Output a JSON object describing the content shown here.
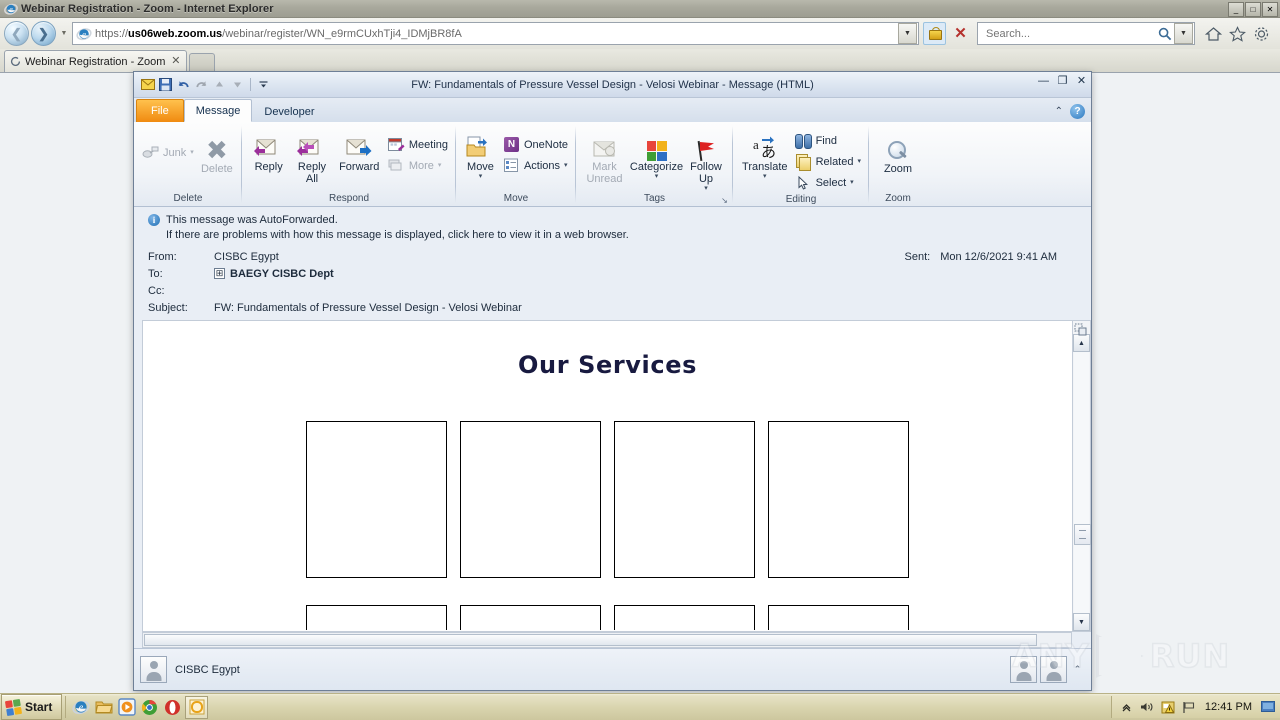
{
  "browser": {
    "title": "Webinar Registration - Zoom - Internet Explorer",
    "icon": "internet-explorer-icon",
    "url_scheme": "https://",
    "url_host": "us06web.zoom.us",
    "url_path": "/webinar/register/WN_e9rmCUxhTji4_IDMjBR8fA",
    "search_placeholder": "Search...",
    "tab_label": "Webinar Registration - Zoom",
    "minimize": "_",
    "restore": "□",
    "close": "✕",
    "back_icon": "back-arrow-icon",
    "forward_icon": "forward-arrow-icon",
    "home_icon": "home-icon",
    "favorites_icon": "star-icon",
    "tools_icon": "gear-icon",
    "lock_icon": "security-lock-icon",
    "stop_icon": "stop-red-x-icon"
  },
  "outlook": {
    "title": "FW: Fundamentals of Pressure Vessel Design - Velosi Webinar  -  Message (HTML)",
    "quick_access": [
      {
        "name": "envelope-icon",
        "glyph": "✉"
      },
      {
        "name": "save-icon",
        "glyph": "■"
      },
      {
        "name": "undo-icon",
        "glyph": "↶"
      },
      {
        "name": "redo-icon",
        "glyph": "↷"
      },
      {
        "name": "previous-item-icon",
        "glyph": "▲"
      },
      {
        "name": "next-item-icon",
        "glyph": "▼"
      },
      {
        "name": "customize-qat-icon",
        "glyph": "▾"
      }
    ],
    "sys": {
      "minimize": "—",
      "restore": "❐",
      "close": "✕"
    },
    "tabs": [
      {
        "label": "File",
        "state": "file"
      },
      {
        "label": "Message",
        "state": "active"
      },
      {
        "label": "Developer",
        "state": "normal"
      }
    ],
    "ribbon_right": {
      "collapse": "⌃",
      "help": "?"
    },
    "ribbon_groups": [
      {
        "name": "Delete",
        "items": [
          {
            "label": "Junk",
            "icon": "junk-icon",
            "type": "small",
            "disabled": true,
            "caret": "▾"
          },
          {
            "label": "Delete",
            "icon": "delete-x-icon",
            "type": "big",
            "disabled": true
          }
        ]
      },
      {
        "name": "Respond",
        "items": [
          {
            "label": "Reply",
            "icon": "reply-icon",
            "type": "big"
          },
          {
            "label": "Reply\nAll",
            "icon": "reply-all-icon",
            "type": "big"
          },
          {
            "label": "Forward",
            "icon": "forward-mail-icon",
            "type": "big"
          },
          {
            "label": "Meeting",
            "icon": "meeting-calendar-icon",
            "type": "small"
          },
          {
            "label": "More",
            "icon": "more-icon",
            "type": "small",
            "disabled": true,
            "caret": "▾"
          }
        ]
      },
      {
        "name": "Move",
        "items": [
          {
            "label": "Move",
            "icon": "move-folder-icon",
            "type": "big",
            "caret": "▾"
          },
          {
            "label": "OneNote",
            "icon": "onenote-icon",
            "type": "small"
          },
          {
            "label": "Actions",
            "icon": "actions-icon",
            "type": "small",
            "caret": "▾"
          }
        ]
      },
      {
        "name": "Tags",
        "items": [
          {
            "label": "Mark\nUnread",
            "icon": "mark-unread-icon",
            "type": "big",
            "disabled": true
          },
          {
            "label": "Categorize",
            "icon": "categorize-icon",
            "type": "big",
            "caret": "▾"
          },
          {
            "label": "Follow\nUp",
            "icon": "follow-up-flag-icon",
            "type": "big",
            "caret": "▾"
          }
        ],
        "dialog_launcher": "↘"
      },
      {
        "name": "Editing",
        "items": [
          {
            "label": "Translate",
            "icon": "translate-icon",
            "type": "big",
            "caret": "▾"
          },
          {
            "label": "Find",
            "icon": "find-binoculars-icon",
            "type": "small"
          },
          {
            "label": "Related",
            "icon": "related-icon",
            "type": "small",
            "caret": "▾"
          },
          {
            "label": "Select",
            "icon": "select-cursor-icon",
            "type": "small",
            "caret": "▾"
          }
        ]
      },
      {
        "name": "Zoom",
        "items": [
          {
            "label": "Zoom",
            "icon": "zoom-magnifier-icon",
            "type": "big"
          }
        ]
      }
    ],
    "info_bar": {
      "icon": "info-icon",
      "line1": "This message was AutoForwarded.",
      "line2": "If there are problems with how this message is displayed, click here to view it in a web browser."
    },
    "headers": {
      "from_label": "From:",
      "from_value": "CISBC Egypt",
      "to_label": "To:",
      "to_value": "BAEGY CISBC Dept",
      "to_expand": "⊞",
      "cc_label": "Cc:",
      "cc_value": "",
      "subject_label": "Subject:",
      "subject_value": "FW: Fundamentals of Pressure Vessel Design - Velosi Webinar",
      "sent_label": "Sent:",
      "sent_value": "Mon 12/6/2021 9:41 AM"
    },
    "message_body": {
      "heading": "Our Services",
      "image_placeholders": 4,
      "image_placeholders_row2": 4
    },
    "scrollbar": {
      "up": "▲",
      "down": "▼",
      "select_object_icon": "select-object-icon"
    },
    "people_pane": {
      "contact_name": "CISBC Egypt",
      "avatar_icon": "contact-avatar-icon",
      "expand": "⌃"
    }
  },
  "taskbar": {
    "start_label": "Start",
    "quick_launch": [
      {
        "name": "internet-explorer-taskbar-icon"
      },
      {
        "name": "file-explorer-taskbar-icon"
      },
      {
        "name": "media-player-taskbar-icon"
      },
      {
        "name": "chrome-taskbar-icon"
      },
      {
        "name": "opera-taskbar-icon"
      },
      {
        "name": "outlook-taskbar-icon",
        "active": true
      }
    ],
    "tray": [
      {
        "name": "show-hidden-icons-icon",
        "glyph": "«"
      },
      {
        "name": "volume-icon",
        "glyph": "🔊"
      },
      {
        "name": "security-alert-icon",
        "glyph": "⚠"
      },
      {
        "name": "network-flag-icon",
        "glyph": "⚑"
      }
    ],
    "time": "12:41 PM",
    "show_desktop_icon": "show-desktop-icon"
  },
  "watermark": {
    "left": "ANY",
    "right": "RUN"
  }
}
